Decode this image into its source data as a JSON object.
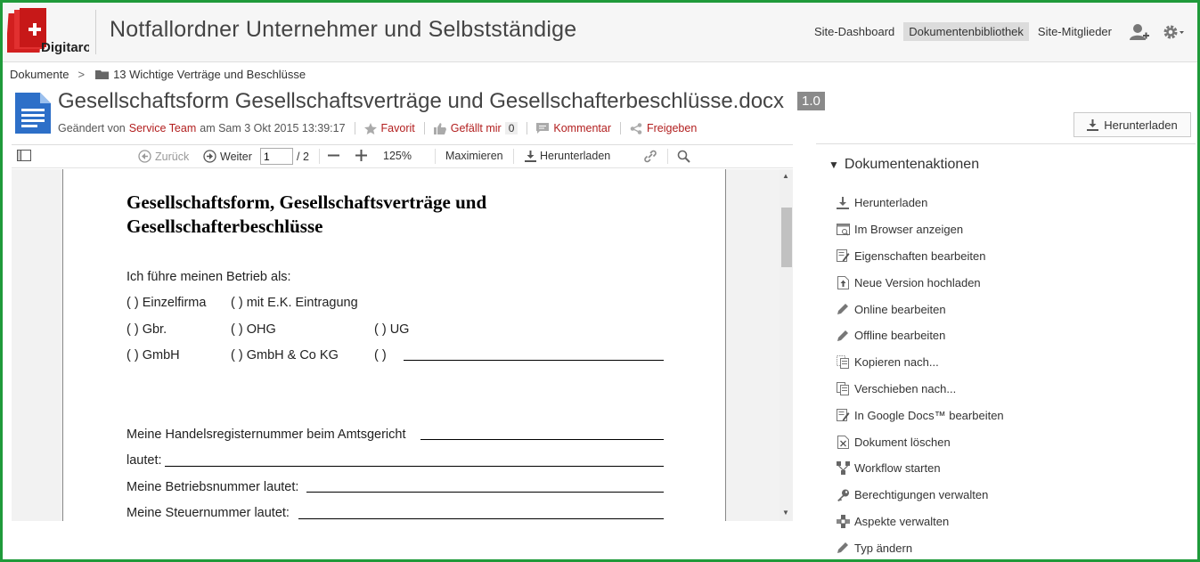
{
  "header": {
    "logo_text": "Digitaro",
    "site_title": "Notfallordner Unternehmer und Selbstständige",
    "nav": [
      {
        "label": "Site-Dashboard"
      },
      {
        "label": "Dokumentenbibliothek"
      },
      {
        "label": "Site-Mitglieder"
      }
    ]
  },
  "breadcrumb": {
    "root": "Dokumente",
    "separator": ">",
    "folder": "13 Wichtige Verträge und Beschlüsse"
  },
  "document": {
    "title": "Gesellschaftsform Gesellschaftsverträge und Gesellschafterbeschlüsse.docx",
    "version": "1.0",
    "modified_prefix": "Geändert von",
    "modified_user": "Service Team",
    "modified_date": "am Sam 3 Okt 2015 13:39:17",
    "favorite": "Favorit",
    "like": "Gefällt mir",
    "like_count": "0",
    "comment": "Kommentar",
    "share": "Freigeben",
    "download_button": "Herunterladen"
  },
  "toolbar": {
    "back": "Zurück",
    "next": "Weiter",
    "page_value": "1",
    "page_total": "/ 2",
    "zoom": "125%",
    "maximize": "Maximieren",
    "download": "Herunterladen"
  },
  "page": {
    "title": "Gesellschaftsform, Gesellschaftsverträge und Gesellschafterbeschlüsse",
    "intro": "Ich führe meinen Betrieb als:",
    "opt_einzelfirma": "(   ) Einzelfirma",
    "opt_ek": "(   ) mit E.K. Eintragung",
    "opt_gbr": "(   ) Gbr.",
    "opt_ohg": "(   )  OHG",
    "opt_ug": "(   ) UG",
    "opt_gmbh": "(   ) GmbH",
    "opt_gmbhco": "(   ) GmbH & Co KG",
    "opt_other": "(   )",
    "hr_number": "Meine Handelsregisternummer beim Amtsgericht",
    "lautet": "lautet:",
    "betriebsnummer": "Meine Betriebsnummer lautet:",
    "steuernummer": "Meine Steuernummer lautet:"
  },
  "side": {
    "heading": "Dokumentenaktionen",
    "actions": [
      {
        "label": "Herunterladen",
        "icon": "download-icon"
      },
      {
        "label": "Im Browser anzeigen",
        "icon": "browser-view-icon"
      },
      {
        "label": "Eigenschaften bearbeiten",
        "icon": "edit-properties-icon"
      },
      {
        "label": "Neue Version hochladen",
        "icon": "upload-icon"
      },
      {
        "label": "Online bearbeiten",
        "icon": "pencil-icon"
      },
      {
        "label": "Offline bearbeiten",
        "icon": "pencil-icon"
      },
      {
        "label": "Kopieren nach...",
        "icon": "copy-icon"
      },
      {
        "label": "Verschieben nach...",
        "icon": "move-icon"
      },
      {
        "label": "In Google Docs™ bearbeiten",
        "icon": "google-docs-icon"
      },
      {
        "label": "Dokument löschen",
        "icon": "delete-icon"
      },
      {
        "label": "Workflow starten",
        "icon": "workflow-icon"
      },
      {
        "label": "Berechtigungen verwalten",
        "icon": "key-icon"
      },
      {
        "label": "Aspekte verwalten",
        "icon": "aspects-icon"
      },
      {
        "label": "Typ ändern",
        "icon": "pencil-icon"
      }
    ]
  },
  "colors": {
    "accent_red": "#b21e1e",
    "frame_green": "#1f9a3a",
    "doc_blue": "#2d6fc8"
  }
}
